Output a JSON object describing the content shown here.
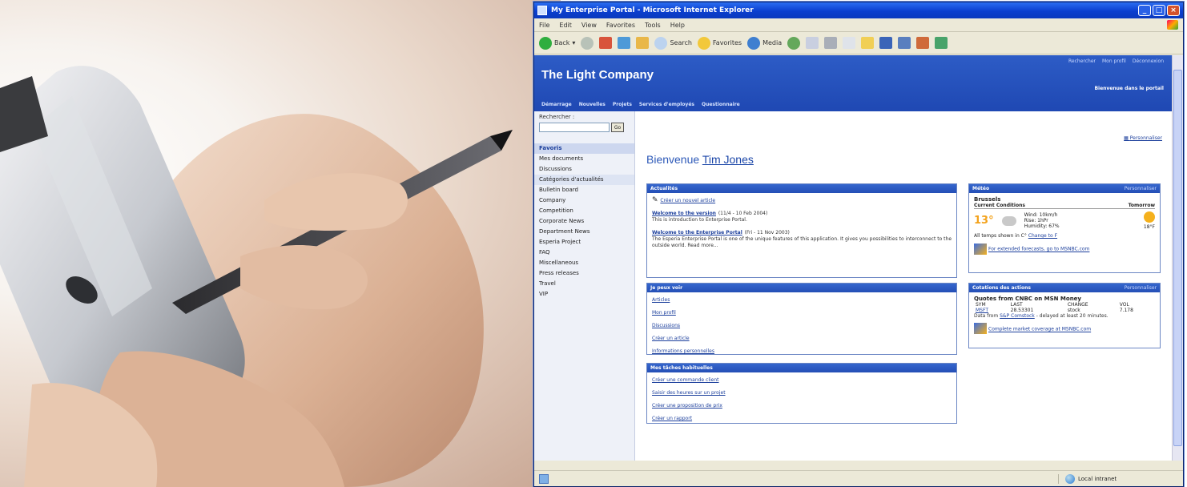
{
  "window": {
    "title": "My Enterprise Portal - Microsoft Internet Explorer",
    "menu": [
      "File",
      "Edit",
      "View",
      "Favorites",
      "Tools",
      "Help"
    ],
    "toolbar": {
      "back": "Back",
      "search": "Search",
      "favorites": "Favorites",
      "media": "Media"
    },
    "status": {
      "zone": "Local intranet"
    }
  },
  "portal": {
    "brand": "The Light Company",
    "toplinks": [
      "Rechercher",
      "Mon profil",
      "Déconnexion"
    ],
    "portal_name": "Bienvenue dans le portail",
    "nav": [
      "Démarrage",
      "Nouvelles",
      "Projets",
      "Services d'employés",
      "Questionnaire"
    ],
    "search": {
      "label": "Rechercher :",
      "go": "Go"
    },
    "sidebar": [
      {
        "label": "Favoris",
        "state": "selected"
      },
      {
        "label": "Mes documents",
        "state": ""
      },
      {
        "label": "Discussions",
        "state": ""
      },
      {
        "label": "Catégories d'actualités",
        "state": "highlight"
      },
      {
        "label": "Bulletin board",
        "state": ""
      },
      {
        "label": "Company",
        "state": ""
      },
      {
        "label": "Competition",
        "state": ""
      },
      {
        "label": "Corporate News",
        "state": ""
      },
      {
        "label": "Department News",
        "state": ""
      },
      {
        "label": "Esperia Project",
        "state": ""
      },
      {
        "label": "FAQ",
        "state": ""
      },
      {
        "label": "Miscellaneous",
        "state": ""
      },
      {
        "label": "Press releases",
        "state": ""
      },
      {
        "label": "Travel",
        "state": ""
      },
      {
        "label": "VIP",
        "state": ""
      }
    ],
    "customize": "Personnaliser",
    "welcome": {
      "prefix": "Bienvenue",
      "user": "Tim Jones"
    }
  },
  "news": {
    "header": "Actualités",
    "create_link": "Créer un nouvel article",
    "items": [
      {
        "title": "Welcome to the version",
        "date": "(11/4 - 10 Feb 2004)",
        "text": "This is introduction to Enterprise Portal."
      },
      {
        "title": "Welcome to the Enterprise Portal",
        "date": "(Fri - 11 Nov 2003)",
        "text": "The Esperia Enterprise Portal is one of the unique features of this application. It gives you possibilities to interconnect to the outside world. Read more..."
      }
    ]
  },
  "quicklinks": {
    "header": "Je peux voir",
    "links": [
      "Articles",
      "Mon profil",
      "Discussions",
      "Créer un article",
      "Informations personnelles"
    ]
  },
  "habits": {
    "header": "Mes tâches habituelles",
    "links": [
      "Créer une commande client",
      "Saisir des heures sur un projet",
      "Créer une proposition de prix",
      "Créer un rapport"
    ]
  },
  "weather": {
    "header": "Météo",
    "customize": "Personnaliser",
    "city": "Brussels",
    "current_label": "Current Conditions",
    "tomorrow_label": "Tomorrow",
    "temp": "13°",
    "details": [
      "Wind: 10km/h",
      "Rise: 1hPr",
      "Humidity: 67%"
    ],
    "tomorrow_temp": "18°F",
    "note": "All temps shown in C°",
    "note_link": "Change to F",
    "msn_link": "For extended forecasts, go to MSNBC.com"
  },
  "stocks": {
    "header": "Cotations des actions",
    "customize": "Personnaliser",
    "title": "Quotes from CNBC on MSN Money",
    "columns": [
      "SYM",
      "LAST",
      "CHANGE",
      "VOL"
    ],
    "rows": [
      [
        "MSFT",
        "28.53301",
        "stock",
        "7.178"
      ]
    ],
    "data_from": "Data from",
    "data_link": "S&P Comstock",
    "delayed": "- delayed at least 20 minutes.",
    "msn_link": "Complete market coverage at MSNBC.com"
  }
}
